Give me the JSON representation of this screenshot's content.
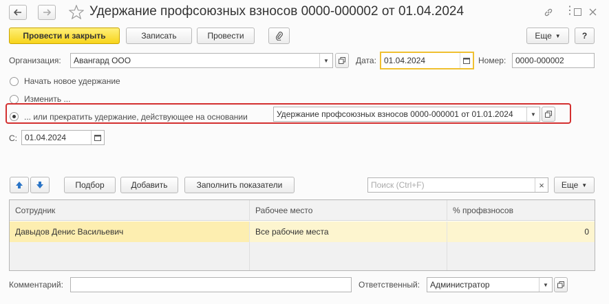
{
  "window": {
    "title": "Удержание профсоюзных взносов 0000-000002 от 01.04.2024",
    "icons": [
      "back-arrow-icon",
      "forward-arrow-icon",
      "star-icon",
      "link-icon",
      "more-dots-icon",
      "maximize-icon",
      "close-icon"
    ]
  },
  "toolbar": {
    "post_close_label": "Провести и закрыть",
    "save_label": "Записать",
    "post_label": "Провести",
    "more_label": "Еще",
    "help_label": "?"
  },
  "header": {
    "org_label": "Организация:",
    "org_value": "Авангард ООО",
    "date_label": "Дата:",
    "date_value": "01.04.2024",
    "number_label": "Номер:",
    "number_value": "0000-000002"
  },
  "mode": {
    "option_new": "Начать новое удержание",
    "option_change": "Изменить ...",
    "option_stop": "... или прекратить удержание, действующее на основании",
    "basis_value": "Удержание профсоюзных взносов 0000-000001 от 01.01.2024",
    "selected": "stop",
    "highlight_color": "#d32f2f"
  },
  "from": {
    "label": "С:",
    "value": "01.04.2024"
  },
  "table_toolbar": {
    "select_label": "Подбор",
    "add_label": "Добавить",
    "fill_label": "Заполнить показатели",
    "search_placeholder": "Поиск (Ctrl+F)",
    "more_label": "Еще"
  },
  "table": {
    "columns": [
      "Сотрудник",
      "Рабочее место",
      "% профвзносов"
    ],
    "rows": [
      {
        "employee": "Давыдов Денис Васильевич",
        "workplace": "Все рабочие места",
        "percent": "0"
      }
    ],
    "selected_row_color": "#fdeeb0"
  },
  "footer": {
    "comment_label": "Комментарий:",
    "comment_value": "",
    "responsible_label": "Ответственный:",
    "responsible_value": "Администратор"
  }
}
